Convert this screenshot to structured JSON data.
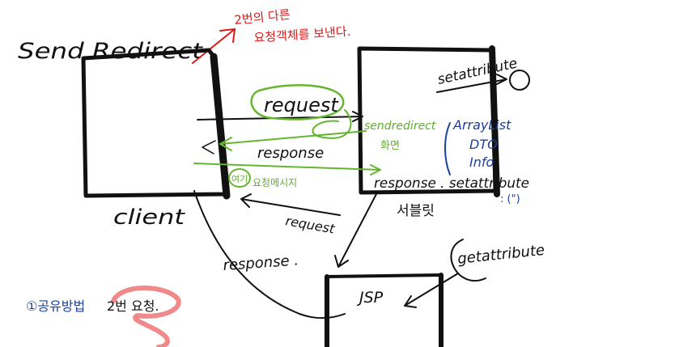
{
  "title": "Send Redirect",
  "red_note": {
    "line1": "2번의 다른",
    "line2": "요청객체를 보낸다."
  },
  "client_label": "client",
  "server_label": "서블릿",
  "jsp_label": "JSP",
  "arrows": {
    "request_top": "request",
    "response_mid": "response",
    "request_bottom": "request",
    "response_bottom": "response ."
  },
  "server_notes": {
    "set_attribute_top": "setattribute",
    "send_redirect": "sendredirect",
    "screen": "화면",
    "response_set_attribute": "response . setattribute",
    "parens": ": (\")"
  },
  "green_notes": {
    "circled": "여기",
    "message": "요청메시지"
  },
  "blue_list": [
    "ArrayList",
    "DTO",
    "Info"
  ],
  "jsp_note": "getattribute",
  "share_note": {
    "prefix": "①공유방법",
    "highlight": "2번 요청."
  },
  "colors": {
    "black": "#111111",
    "red": "#d81b1b",
    "green": "#66b531",
    "blue": "#1c3f9c",
    "pink": "#f08a8a"
  }
}
